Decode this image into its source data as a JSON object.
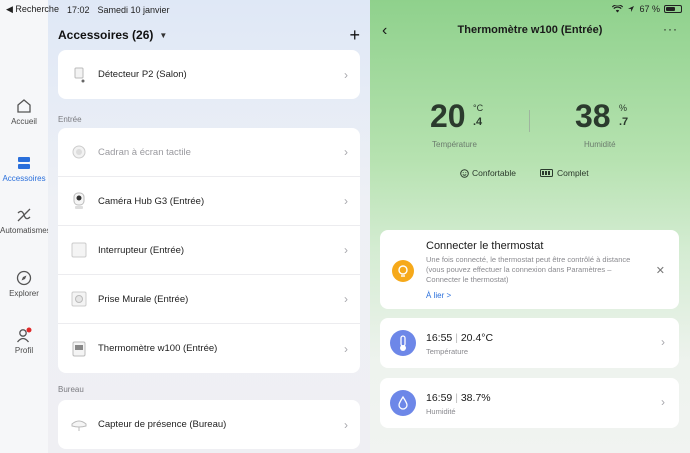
{
  "status": {
    "back_label": "◀ Recherche",
    "time": "17:02",
    "date": "Samedi 10 janvier",
    "battery": "67 %",
    "battery_level": 0.67
  },
  "rail": [
    {
      "label": "Accueil",
      "icon": "home-icon"
    },
    {
      "label": "Accessoires",
      "icon": "accessories-icon",
      "active": true
    },
    {
      "label": "Automatismes",
      "icon": "automation-icon"
    },
    {
      "label": "Explorer",
      "icon": "compass-icon"
    },
    {
      "label": "Profil",
      "icon": "profile-icon"
    }
  ],
  "accessories": {
    "title": "Accessoires (26)",
    "top_device": "Détecteur P2 (Salon)",
    "section_entree": "Entrée",
    "entree_devices": [
      {
        "name": "Cadran à écran tactile",
        "dim": true
      },
      {
        "name": "Caméra Hub G3 (Entrée)"
      },
      {
        "name": "Interrupteur (Entrée)"
      },
      {
        "name": "Prise Murale (Entrée)"
      },
      {
        "name": "Thermomètre w100 (Entrée)"
      }
    ],
    "section_bureau": "Bureau",
    "bureau_device": "Capteur de présence (Bureau)"
  },
  "detail": {
    "title": "Thermomètre w100 (Entrée)",
    "temp_int": "20",
    "temp_unit": "°C",
    "temp_dec": ".4",
    "temp_label": "Température",
    "hum_int": "38",
    "hum_unit": "%",
    "hum_dec": ".7",
    "hum_label": "Humidité",
    "comfort": "Confortable",
    "complete": "Complet",
    "connect": {
      "title": "Connecter le thermostat",
      "desc": "Une fois connecté, le thermostat peut être contrôlé à distance (vous pouvez effectuer la connexion dans Paramètres – Connecter le thermostat)",
      "link": "À lier >"
    },
    "records": [
      {
        "time": "16:55",
        "value": "20.4°C",
        "label": "Température"
      },
      {
        "time": "16:59",
        "value": "38.7%",
        "label": "Humidité"
      }
    ]
  },
  "colors": {
    "accent": "#2a6fdb",
    "warning": "#f6a91a",
    "sensor": "#6d87e8"
  }
}
